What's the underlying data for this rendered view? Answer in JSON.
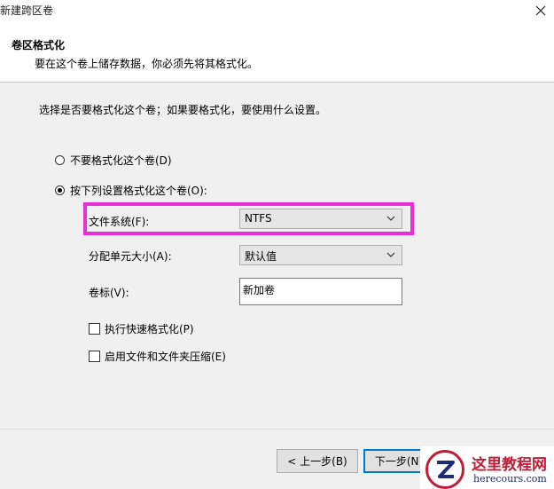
{
  "window": {
    "title": "新建跨区卷"
  },
  "header": {
    "title": "卷区格式化",
    "subtitle": "要在这个卷上储存数据，你必须先将其格式化。"
  },
  "content": {
    "prompt": "选择是否要格式化这个卷；如果要格式化，要使用什么设置。",
    "radio_no_format": {
      "label": "不要格式化这个卷(D)",
      "checked": false
    },
    "radio_format": {
      "label": "按下列设置格式化这个卷(O):",
      "checked": true
    },
    "file_system": {
      "label": "文件系统(F):",
      "value": "NTFS"
    },
    "allocation_unit": {
      "label": "分配单元大小(A):",
      "value": "默认值"
    },
    "volume_label": {
      "label": "卷标(V):",
      "value": "新加卷"
    },
    "quick_format": {
      "label": "执行快速格式化(P)",
      "checked": false
    },
    "compression": {
      "label": "启用文件和文件夹压缩(E)",
      "checked": false
    }
  },
  "footer": {
    "back_label": "< 上一步(B)",
    "next_label": "下一步(N)"
  },
  "watermark": {
    "title": "这里教程网",
    "url": "herecours.com"
  },
  "colors": {
    "highlight": "#e92ddb",
    "primary_button_border": "#0078d7",
    "watermark_red": "#c21d35"
  }
}
